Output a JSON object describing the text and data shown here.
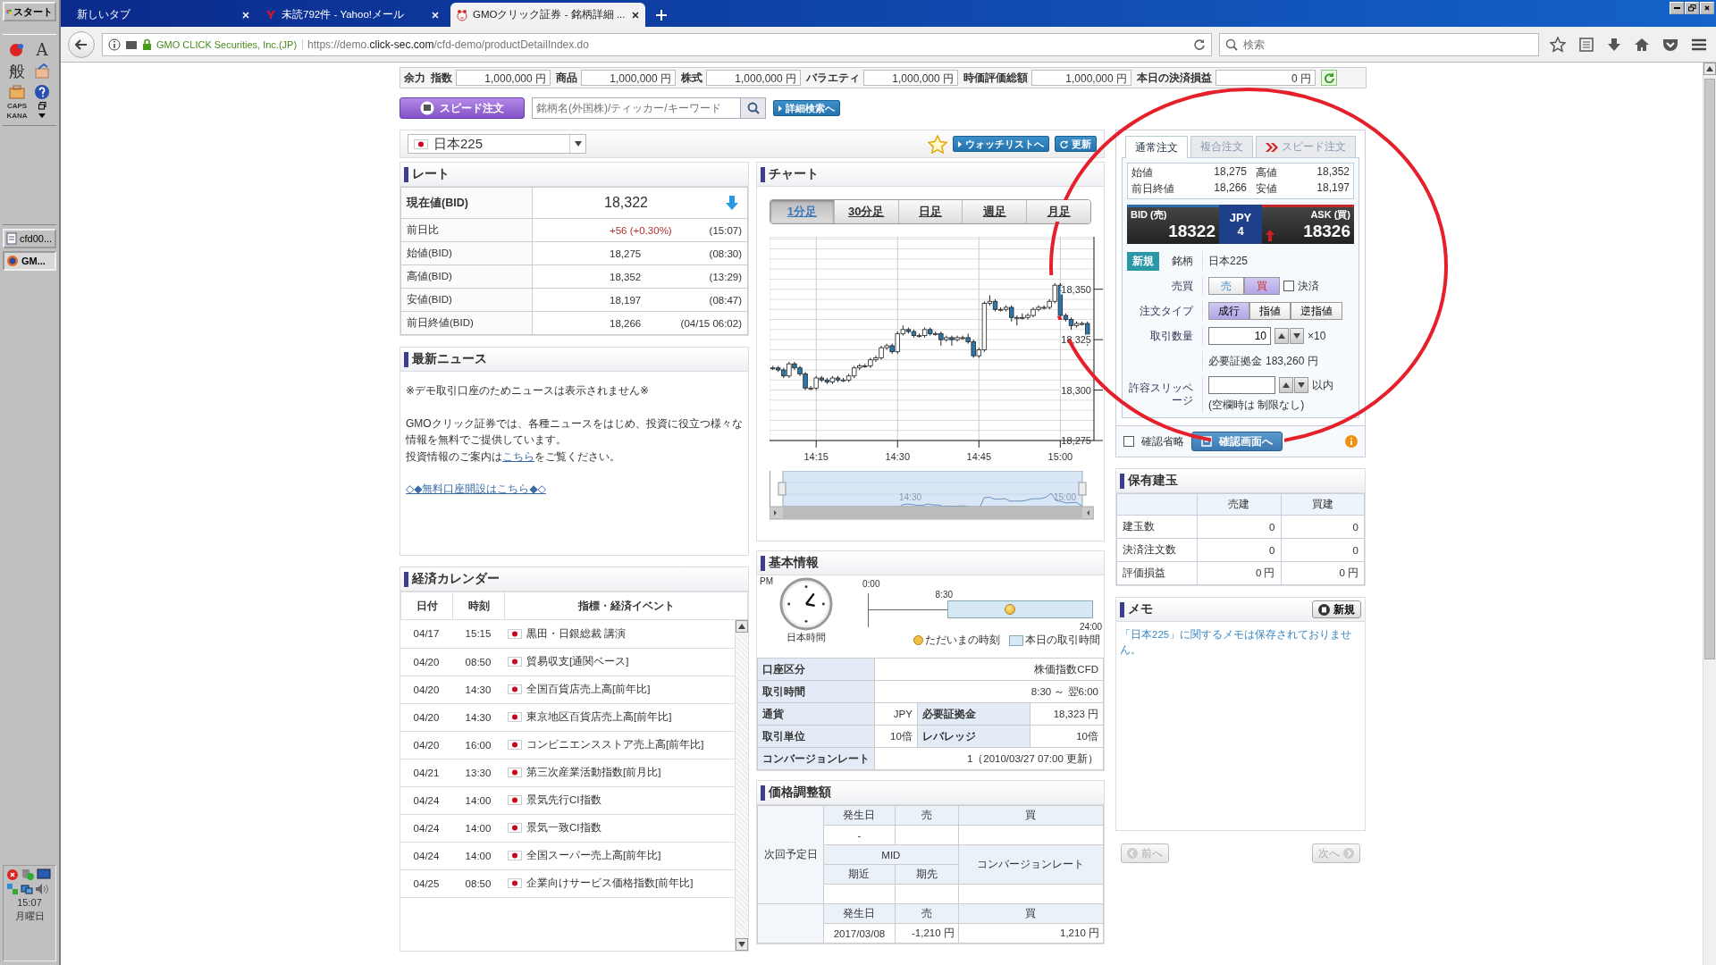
{
  "taskbar": {
    "start": "スタート",
    "ime": {
      "mode": "A",
      "kanji": "般",
      "caps": "CAPS",
      "kana": "KANA"
    },
    "tasks": [
      {
        "label": "cfd00...",
        "selected": false
      },
      {
        "label": "GM...",
        "selected": true
      }
    ],
    "clock": {
      "time": "15:07",
      "day": "月曜日"
    }
  },
  "browser": {
    "tabs": [
      {
        "label": "新しいタブ",
        "selected": false,
        "kind": "blank"
      },
      {
        "label": "未読792件 - Yahoo!メール",
        "selected": false,
        "kind": "mail"
      },
      {
        "label": "GMOクリック証券 - 銘柄詳細 ...",
        "selected": true,
        "kind": "site"
      }
    ],
    "identity": "GMO CLICK Securities, Inc.(JP)",
    "url": "https://demo.**click-sec.com**/cfd-demo/productDetailIndex.do",
    "search": {
      "placeholder": "検索"
    }
  },
  "balance": {
    "label": "余力",
    "items": [
      {
        "label": "指数",
        "value": "1,000,000 円"
      },
      {
        "label": "商品",
        "value": "1,000,000 円"
      },
      {
        "label": "株式",
        "value": "1,000,000 円"
      },
      {
        "label": "バラエティ",
        "value": "1,000,000 円"
      },
      {
        "label": "時価評価総額",
        "value": "1,000,000 円"
      },
      {
        "label": "本日の決済損益",
        "value": "0 円"
      }
    ]
  },
  "search": {
    "speed_order": "スピード注文",
    "placeholder": "銘柄名(外国株)/ティッカー/キーワード",
    "advanced": "詳細検索へ"
  },
  "symbol": {
    "name": "日本225",
    "watchlist": "ウォッチリストへ",
    "refresh": "更新"
  },
  "rate": {
    "title": "レート",
    "current": {
      "label": "現在値(BID)",
      "value": "18,322",
      "falling": true
    },
    "rows": [
      {
        "label": "前日比",
        "value": "+56 (+0.30%)",
        "time": "(15:07)",
        "kind": "change"
      },
      {
        "label": "始値(BID)",
        "value": "18,275",
        "time": "(08:30)",
        "kind": "price"
      },
      {
        "label": "高値(BID)",
        "value": "18,352",
        "time": "(13:29)",
        "kind": "price"
      },
      {
        "label": "安値(BID)",
        "value": "18,197",
        "time": "(08:47)",
        "kind": "price"
      },
      {
        "label": "前日終値(BID)",
        "value": "18,266",
        "time": "(04/15 06:02)",
        "kind": "price"
      }
    ]
  },
  "news": {
    "title": "最新ニュース",
    "notice": "※デモ取引口座のためニュースは表示されません※",
    "body": "GMOクリック証券では、各種ニュースをはじめ、投資に役立つ様々な情報を無料でご提供しています。",
    "guide_before": "投資情報のご案内は",
    "guide_link": "こちら",
    "guide_after": "をご覧ください。",
    "signup_link": "◇◆無料口座開設はこちら◆◇"
  },
  "calendar": {
    "title": "経済カレンダー",
    "columns": [
      "日付",
      "時刻",
      "指標・経済イベント"
    ],
    "rows": [
      {
        "date": "04/17",
        "time": "15:15",
        "event": "黒田・日銀総裁 講演"
      },
      {
        "date": "04/20",
        "time": "08:50",
        "event": "貿易収支[通関ベース]"
      },
      {
        "date": "04/20",
        "time": "14:30",
        "event": "全国百貨店売上高[前年比]"
      },
      {
        "date": "04/20",
        "time": "14:30",
        "event": "東京地区百貨店売上高[前年比]"
      },
      {
        "date": "04/20",
        "time": "16:00",
        "event": "コンビニエンスストア売上高[前年比]"
      },
      {
        "date": "04/21",
        "time": "13:30",
        "event": "第三次産業活動指数[前月比]"
      },
      {
        "date": "04/24",
        "time": "14:00",
        "event": "景気先行CI指数"
      },
      {
        "date": "04/24",
        "time": "14:00",
        "event": "景気一致CI指数"
      },
      {
        "date": "04/24",
        "time": "14:00",
        "event": "全国スーパー売上高[前年比]"
      },
      {
        "date": "04/25",
        "time": "08:50",
        "event": "企業向けサービス価格指数[前年比]"
      }
    ]
  },
  "chart": {
    "title": "チャート",
    "periods": [
      {
        "label": "1分足",
        "selected": true
      },
      {
        "label": "30分足",
        "selected": false
      },
      {
        "label": "日足",
        "selected": false
      },
      {
        "label": "週足",
        "selected": false
      },
      {
        "label": "月足",
        "selected": false
      }
    ],
    "chart_data": {
      "type": "candlestick",
      "grid": true,
      "x": [
        847,
        848,
        849,
        850,
        851,
        852,
        853,
        854,
        855,
        856,
        857,
        858,
        859,
        860,
        861,
        862,
        863,
        864,
        865,
        866,
        867,
        868,
        869,
        870,
        871,
        872,
        873,
        874,
        875,
        876,
        877,
        878,
        879,
        880,
        881,
        882,
        883,
        884,
        885,
        886,
        887,
        888,
        889,
        890,
        891,
        892,
        893,
        894,
        895,
        896,
        897,
        898,
        899,
        900,
        901,
        902,
        903,
        904,
        905
      ],
      "ohlc": [
        [
          18311,
          18312,
          18310,
          18311
        ],
        [
          18311,
          18312,
          18309,
          18310
        ],
        [
          18310,
          18311,
          18306,
          18307
        ],
        [
          18307,
          18314,
          18306,
          18313
        ],
        [
          18313,
          18314,
          18310,
          18311
        ],
        [
          18311,
          18312,
          18307,
          18308
        ],
        [
          18308,
          18309,
          18300,
          18301
        ],
        [
          18301,
          18302,
          18300,
          18301
        ],
        [
          18301,
          18307,
          18300,
          18306
        ],
        [
          18306,
          18307,
          18304,
          18305
        ],
        [
          18305,
          18306,
          18303,
          18304
        ],
        [
          18304,
          18307,
          18303,
          18306
        ],
        [
          18306,
          18307,
          18304,
          18305
        ],
        [
          18305,
          18306,
          18304,
          18305
        ],
        [
          18305,
          18308,
          18304,
          18307
        ],
        [
          18307,
          18312,
          18306,
          18311
        ],
        [
          18311,
          18313,
          18310,
          18312
        ],
        [
          18312,
          18313,
          18311,
          18312
        ],
        [
          18312,
          18316,
          18311,
          18315
        ],
        [
          18315,
          18317,
          18314,
          18316
        ],
        [
          18316,
          18322,
          18315,
          18321
        ],
        [
          18321,
          18323,
          18320,
          18322
        ],
        [
          18322,
          18323,
          18318,
          18319
        ],
        [
          18319,
          18329,
          18318,
          18328
        ],
        [
          18328,
          18332,
          18327,
          18330
        ],
        [
          18330,
          18331,
          18328,
          18329
        ],
        [
          18329,
          18330,
          18326,
          18327
        ],
        [
          18327,
          18328,
          18326,
          18327
        ],
        [
          18327,
          18331,
          18326,
          18330
        ],
        [
          18330,
          18331,
          18327,
          18328
        ],
        [
          18328,
          18329,
          18327,
          18328
        ],
        [
          18328,
          18329,
          18322,
          18325
        ],
        [
          18325,
          18327,
          18324,
          18326
        ],
        [
          18326,
          18327,
          18322,
          18325
        ],
        [
          18325,
          18327,
          18324,
          18326
        ],
        [
          18326,
          18327,
          18325,
          18326
        ],
        [
          18326,
          18328,
          18323,
          18324
        ],
        [
          18324,
          18325,
          18316,
          18317
        ],
        [
          18317,
          18321,
          18316,
          18320
        ],
        [
          18320,
          18344,
          18319,
          18343
        ],
        [
          18343,
          18347,
          18342,
          18344
        ],
        [
          18344,
          18345,
          18339,
          18340
        ],
        [
          18340,
          18341,
          18339,
          18340
        ],
        [
          18340,
          18342,
          18339,
          18341
        ],
        [
          18341,
          18342,
          18334,
          18336
        ],
        [
          18336,
          18337,
          18332,
          18336
        ],
        [
          18336,
          18338,
          18335,
          18336
        ],
        [
          18336,
          18338,
          18335,
          18337
        ],
        [
          18337,
          18341,
          18336,
          18340
        ],
        [
          18340,
          18342,
          18339,
          18341
        ],
        [
          18341,
          18342,
          18340,
          18341
        ],
        [
          18341,
          18345,
          18340,
          18344
        ],
        [
          18344,
          18353,
          18343,
          18352
        ],
        [
          18352,
          18353,
          18336,
          18337
        ],
        [
          18337,
          18338,
          18334,
          18335
        ],
        [
          18335,
          18336,
          18330,
          18332
        ],
        [
          18332,
          18334,
          18331,
          18333
        ],
        [
          18333,
          18334,
          18332,
          18333
        ],
        [
          18333,
          18334,
          18322,
          18326
        ]
      ],
      "xlim": [
        846.4,
        906.2
      ],
      "ylim": [
        18275,
        18376
      ],
      "xticks": [
        {
          "value": 855,
          "label": "14:15"
        },
        {
          "value": 870,
          "label": "14:30"
        },
        {
          "value": 885,
          "label": "14:45"
        },
        {
          "value": 900,
          "label": "15:00"
        }
      ],
      "yticks": [
        {
          "value": 18350,
          "label": "18,350"
        },
        {
          "value": 18325,
          "label": "18,325"
        },
        {
          "value": 18300,
          "label": "18,300"
        },
        {
          "value": 18275,
          "label": "18,275"
        }
      ]
    },
    "navigator": {
      "labels": [
        "14:30",
        "15:00"
      ]
    }
  },
  "basic_info": {
    "title": "基本情報",
    "clock_label": "PM",
    "timezone": "日本時間",
    "timeline": {
      "start": "0:00",
      "open": "8:30",
      "end": "24:00",
      "level": 0.63
    },
    "legend": [
      "ただいまの時刻",
      "本日の取引時間"
    ],
    "rows": [
      {
        "cells": [
          {
            "label": "口座区分",
            "value": "株価指数CFD"
          }
        ]
      },
      {
        "cells": [
          {
            "label": "取引時間",
            "value": "8:30 ～ 翌6:00"
          }
        ]
      },
      {
        "cells": [
          {
            "label": "通貨",
            "value": "JPY"
          },
          {
            "label": "必要証拠金",
            "value": "18,323 円"
          }
        ]
      },
      {
        "cells": [
          {
            "label": "取引単位",
            "value": "10倍"
          },
          {
            "label": "レバレッジ",
            "value": "10倍"
          }
        ]
      },
      {
        "cells": [
          {
            "label": "コンバージョンレート",
            "value": "1（2010/03/27 07:00 更新）"
          }
        ]
      }
    ]
  },
  "price_adjustment": {
    "title": "価格調整額",
    "next_label": "次回予定日",
    "headers": [
      "発生日",
      "売",
      "買"
    ],
    "next_date": "-",
    "mid": "MID",
    "conversion": "コンバージョンレート",
    "near": "期近",
    "far": "期先",
    "headers_2": [
      "発生日",
      "売",
      "買"
    ],
    "last": {
      "date": "2017/03/08",
      "sell": "-1,210 円",
      "buy": "1,210 円"
    }
  },
  "order": {
    "tabs": [
      {
        "label": "通常注文",
        "selected": true
      },
      {
        "label": "複合注文",
        "selected": false
      },
      {
        "label": "スピード注文",
        "selected": false
      }
    ],
    "summary": [
      {
        "label": "始値",
        "value": "18,275"
      },
      {
        "label": "高値",
        "value": "18,352"
      },
      {
        "label": "前日終値",
        "value": "18,266"
      },
      {
        "label": "安値",
        "value": "18,197"
      }
    ],
    "quote": {
      "bid_label": "BID (売)",
      "bid": "18322",
      "currency": "JPY",
      "spread": "4",
      "ask_label": "ASK (買)",
      "ask": "18326",
      "rising": true
    },
    "form": {
      "mode": "新規",
      "symbol_label": "銘柄",
      "symbol": "日本225",
      "side_label": "売買",
      "sides": [
        {
          "label": "売",
          "selected": false,
          "kind": "sell"
        },
        {
          "label": "買",
          "selected": true,
          "kind": "buy"
        }
      ],
      "settle": {
        "label": "決済",
        "checked": false
      },
      "type_label": "注文タイプ",
      "types": [
        {
          "label": "成行",
          "selected": true
        },
        {
          "label": "指値",
          "selected": false
        },
        {
          "label": "逆指値",
          "selected": false
        }
      ],
      "qty_label": "取引数量",
      "qty": "10",
      "multiplier": "×10",
      "margin_label": "必要証拠金",
      "margin": "183,260 円",
      "slip_label": "許容スリッページ",
      "slip_unit": "以内",
      "slip_note": "(空欄時は 制限なし)"
    },
    "skip_confirm": {
      "label": "確認省略",
      "checked": false
    },
    "confirm": "確認画面へ"
  },
  "positions": {
    "title": "保有建玉",
    "columns": [
      "売建",
      "買建"
    ],
    "rows": [
      {
        "label": "建玉数",
        "sell": "0",
        "buy": "0"
      },
      {
        "label": "決済注文数",
        "sell": "0",
        "buy": "0"
      },
      {
        "label": "評価損益",
        "sell": "0 円",
        "buy": "0 円"
      }
    ]
  },
  "memo": {
    "title": "メモ",
    "new": "新規",
    "message": "「日本225」に関するメモは保存されておりません。",
    "pager": [
      {
        "label": "前へ",
        "disabled": true
      },
      {
        "label": "次へ",
        "disabled": true
      }
    ]
  },
  "annotation": {
    "kind": "circle"
  }
}
